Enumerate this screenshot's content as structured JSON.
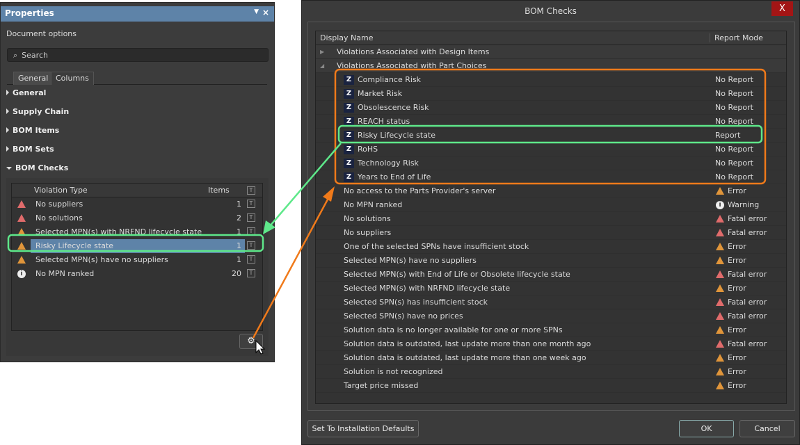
{
  "properties": {
    "title": "Properties",
    "subtitle": "Document options",
    "search_placeholder": "Search",
    "tabs": [
      "General",
      "Columns"
    ],
    "sections": [
      "General",
      "Supply Chain",
      "BOM Items",
      "BOM Sets",
      "BOM Checks"
    ],
    "table": {
      "headers": [
        "Violation Type",
        "Items"
      ],
      "filter_glyph": "T",
      "rows": [
        {
          "icon": "error-icon",
          "label": "No suppliers",
          "count": "1"
        },
        {
          "icon": "error-icon",
          "label": "No solutions",
          "count": "2"
        },
        {
          "icon": "warning-icon",
          "label": "Selected MPN(s) with NRFND lifecycle state",
          "count": "1"
        },
        {
          "icon": "warning-icon",
          "label": "Risky Lifecycle state",
          "count": "1",
          "selected": true
        },
        {
          "icon": "warning-icon",
          "label": "Selected MPN(s) have no suppliers",
          "count": "1"
        },
        {
          "icon": "info-icon",
          "label": "No MPN ranked",
          "count": "20"
        }
      ]
    }
  },
  "dialog": {
    "title": "BOM Checks",
    "close": "X",
    "headers": [
      "Display Name",
      "Report Mode"
    ],
    "groups": [
      "Violations Associated with Design Items",
      "Violations Associated with Part Choices"
    ],
    "part_items": [
      {
        "label": "Compliance Risk",
        "mode": "No Report"
      },
      {
        "label": "Market Risk",
        "mode": "No Report"
      },
      {
        "label": "Obsolescence Risk",
        "mode": "No Report"
      },
      {
        "label": "REACH status",
        "mode": "No Report"
      },
      {
        "label": "Risky Lifecycle state",
        "mode": "Report"
      },
      {
        "label": "RoHS",
        "mode": "No Report"
      },
      {
        "label": "Technology Risk",
        "mode": "No Report"
      },
      {
        "label": "Years to End of Life",
        "mode": "No Report"
      }
    ],
    "checks": [
      {
        "label": "No access to the Parts Provider's server",
        "mode": "Error"
      },
      {
        "label": "No MPN ranked",
        "mode": "Warning"
      },
      {
        "label": "No solutions",
        "mode": "Fatal error"
      },
      {
        "label": "No suppliers",
        "mode": "Fatal error"
      },
      {
        "label": "One of the selected SPNs have insufficient stock",
        "mode": "Error"
      },
      {
        "label": "Selected MPN(s) have no suppliers",
        "mode": "Error"
      },
      {
        "label": "Selected MPN(s) with End of Life or Obsolete lifecycle state",
        "mode": "Fatal error"
      },
      {
        "label": "Selected MPN(s) with NRFND lifecycle state",
        "mode": "Error"
      },
      {
        "label": "Selected SPN(s) has insufficient stock",
        "mode": "Fatal error"
      },
      {
        "label": "Selected SPN(s) have no prices",
        "mode": "Fatal error"
      },
      {
        "label": "Solution data is no longer available for one or more SPNs",
        "mode": "Error"
      },
      {
        "label": "Solution data is outdated, last update more than one month ago",
        "mode": "Fatal error"
      },
      {
        "label": "Solution data is outdated, last update more than one week ago",
        "mode": "Error"
      },
      {
        "label": "Solution is not recognized",
        "mode": "Error"
      },
      {
        "label": "Target price missed",
        "mode": "Error"
      }
    ],
    "buttons": {
      "defaults": "Set To Installation Defaults",
      "ok": "OK",
      "cancel": "Cancel"
    }
  },
  "colors": {
    "accent": "#5e83a8",
    "highlight_green": "#5ee88a",
    "highlight_orange": "#f07a1a"
  }
}
